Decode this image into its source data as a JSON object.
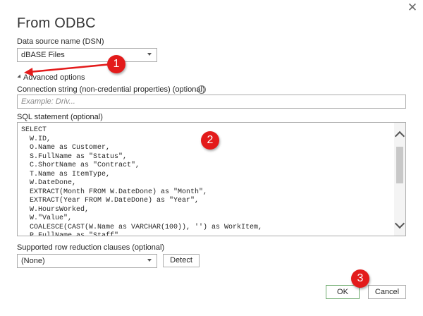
{
  "dialog": {
    "title": "From ODBC",
    "close_icon": "close-icon",
    "close_glyph": "✕"
  },
  "dsn": {
    "label": "Data source name (DSN)",
    "value": "dBASE Files"
  },
  "advanced": {
    "label": "Advanced options"
  },
  "connection": {
    "label": "Connection string (non-credential properties) (optional)",
    "info_glyph": "i",
    "placeholder": "Example: Driv..."
  },
  "sql": {
    "label": "SQL statement (optional)",
    "text": "SELECT\n  W.ID,\n  O.Name as Customer,\n  S.FullName as \"Status\",\n  C.ShortName as \"Contract\",\n  T.Name as ItemType,\n  W.DateDone,\n  EXTRACT(Month FROM W.DateDone) as \"Month\",\n  EXTRACT(Year FROM W.DateDone) as \"Year\",\n  W.HoursWorked,\n  W.\"Value\",\n  COALESCE(CAST(W.Name as VARCHAR(100)), '') as WorkItem,\n  P.FullName as \"Staff\","
  },
  "reduction": {
    "label": "Supported row reduction clauses (optional)",
    "value": "(None)",
    "detect_label": "Detect"
  },
  "footer": {
    "ok_label": "OK",
    "cancel_label": "Cancel"
  },
  "annotations": {
    "badge1": "1",
    "badge2": "2",
    "badge3": "3",
    "color": "#e31b1b"
  }
}
